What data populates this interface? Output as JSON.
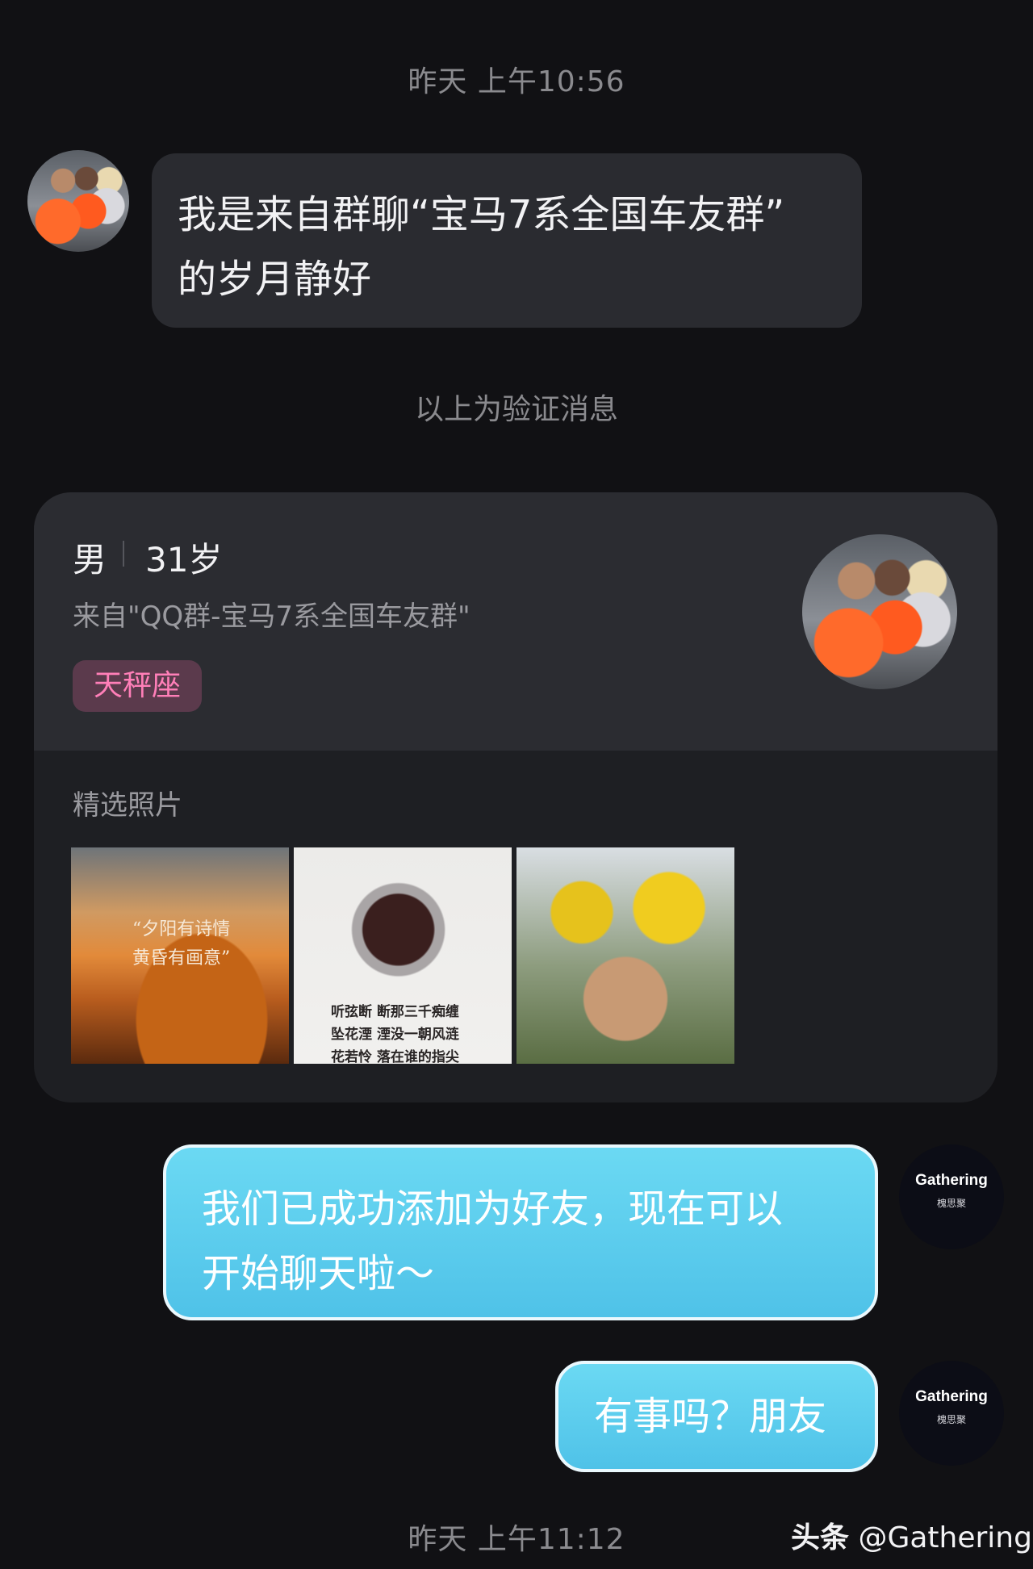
{
  "timestamps": {
    "top": "昨天 上午10:56",
    "bottom": "昨天 上午11:12"
  },
  "incoming_message": {
    "text_line1": "我是来自群聊“宝马7系全国车友群”",
    "text_line2": "的岁月静好"
  },
  "verify_note": "以上为验证消息",
  "profile_card": {
    "gender": "男",
    "age": "31岁",
    "source": "来自\"QQ群-宝马7系全国车友群\"",
    "tag": "天秤座",
    "photos_label": "精选照片",
    "photos": [
      {
        "name": "sunset-poem-photo",
        "line1": "“夕阳有诗情",
        "line2": "黄昏有画意”"
      },
      {
        "name": "ink-painting-photo",
        "line1": "听弦断 断那三千痴缠",
        "line2": "坠花湮 湮没一朝风涟",
        "line3": "花若怜 落在谁的指尖"
      },
      {
        "name": "sunflower-girl-photo"
      }
    ]
  },
  "outgoing_messages": [
    {
      "line1": "我们已成功添加为好友，现在可以",
      "line2": "开始聊天啦～"
    },
    {
      "text": "有事吗？朋友"
    }
  ],
  "my_avatar": {
    "brand": "Gathering",
    "brand_sub": "槐思聚"
  },
  "watermark": {
    "platform": "头条",
    "handle": "@Gathering"
  }
}
